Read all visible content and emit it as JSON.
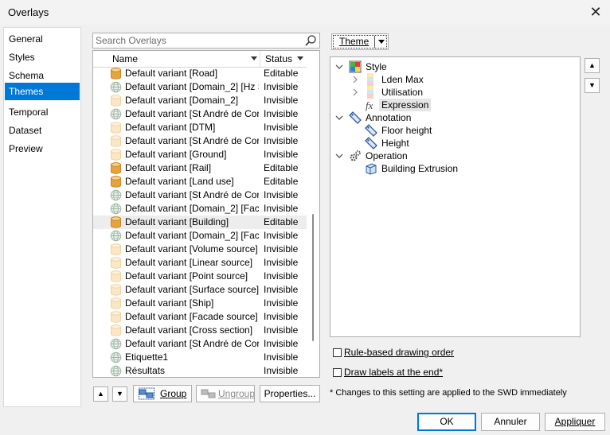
{
  "window": {
    "title": "Overlays"
  },
  "nav": {
    "items": [
      {
        "label": "General"
      },
      {
        "label": "Styles"
      },
      {
        "label": "Schema"
      },
      {
        "label": "Themes"
      },
      {
        "label": "Temporal"
      },
      {
        "label": "Dataset"
      },
      {
        "label": "Preview"
      }
    ],
    "selected": "Themes"
  },
  "search": {
    "placeholder": "Search Overlays",
    "value": ""
  },
  "list": {
    "headers": {
      "name": "Name",
      "status": "Status"
    },
    "rows": [
      {
        "name": "Default variant [Road]",
        "status": "Editable",
        "icon": "database-icon"
      },
      {
        "name": "Default variant [Domain_2] [Hz Si...",
        "status": "Invisible",
        "icon": "globe-icon"
      },
      {
        "name": "Default variant [Domain_2]",
        "status": "Invisible",
        "icon": "database-faded-icon"
      },
      {
        "name": "Default variant [St André de Corc...",
        "status": "Invisible",
        "icon": "globe-icon"
      },
      {
        "name": "Default variant [DTM]",
        "status": "Invisible",
        "icon": "database-faded-icon"
      },
      {
        "name": "Default variant [St André de Corcy]",
        "status": "Invisible",
        "icon": "database-faded-icon"
      },
      {
        "name": "Default variant [Ground]",
        "status": "Invisible",
        "icon": "database-faded-icon"
      },
      {
        "name": "Default variant [Rail]",
        "status": "Editable",
        "icon": "database-icon"
      },
      {
        "name": "Default variant [Land use]",
        "status": "Editable",
        "icon": "database-icon"
      },
      {
        "name": "Default variant [St André de Corc...",
        "status": "Invisible",
        "icon": "globe-icon"
      },
      {
        "name": "Default variant [Domain_2] [Faca...",
        "status": "Invisible",
        "icon": "globe-icon"
      },
      {
        "name": "Default variant [Building]",
        "status": "Editable",
        "icon": "database-icon",
        "selected": true
      },
      {
        "name": "Default variant [Domain_2] [Faca...",
        "status": "Invisible",
        "icon": "globe-icon"
      },
      {
        "name": "Default variant [Volume source]",
        "status": "Invisible",
        "icon": "database-faded-icon"
      },
      {
        "name": "Default variant [Linear source]",
        "status": "Invisible",
        "icon": "database-faded-icon"
      },
      {
        "name": "Default variant [Point source]",
        "status": "Invisible",
        "icon": "database-faded-icon"
      },
      {
        "name": "Default variant [Surface source]",
        "status": "Invisible",
        "icon": "database-faded-icon"
      },
      {
        "name": "Default variant [Ship]",
        "status": "Invisible",
        "icon": "database-faded-icon"
      },
      {
        "name": "Default variant [Facade source]",
        "status": "Invisible",
        "icon": "database-faded-icon"
      },
      {
        "name": "Default variant [Cross section]",
        "status": "Invisible",
        "icon": "database-faded-icon"
      },
      {
        "name": "Default variant [St André de Corc...",
        "status": "Invisible",
        "icon": "globe-icon"
      },
      {
        "name": "Etiquette1",
        "status": "Invisible",
        "icon": "globe-icon"
      },
      {
        "name": "Résultats",
        "status": "Invisible",
        "icon": "globe-icon"
      }
    ]
  },
  "list_buttons": {
    "up": "▲",
    "down": "▼",
    "group": "Group",
    "ungroup": "Ungroup",
    "properties": "Properties..."
  },
  "theme": {
    "button_label": "Theme",
    "tree": [
      {
        "label": "Style",
        "level": 0,
        "icon": "style-palette-icon",
        "expander": "down"
      },
      {
        "label": "Lden Max",
        "level": 1,
        "icon": "color-ramp-icon",
        "expander": "right"
      },
      {
        "label": "Utilisation",
        "level": 1,
        "icon": "color-ramp-icon",
        "expander": "right"
      },
      {
        "label": "Expression",
        "level": 1,
        "icon": "fx-icon",
        "expander": "",
        "selected": true
      },
      {
        "label": "Annotation",
        "level": 0,
        "icon": "tag-icon",
        "expander": "down"
      },
      {
        "label": "Floor height",
        "level": 1,
        "icon": "tag-icon",
        "expander": ""
      },
      {
        "label": "Height",
        "level": 1,
        "icon": "tag-icon",
        "expander": ""
      },
      {
        "label": "Operation",
        "level": 0,
        "icon": "gears-icon",
        "expander": "down"
      },
      {
        "label": "Building Extrusion",
        "level": 1,
        "icon": "building-icon",
        "expander": ""
      }
    ],
    "move_up": "▲",
    "move_down": "▼"
  },
  "options": {
    "rule_based": {
      "label": "Rule-based drawing order",
      "checked": false
    },
    "draw_labels": {
      "label": "Draw labels at the end*",
      "checked": false
    },
    "note": "* Changes to this setting are applied to the SWD immediately"
  },
  "footer": {
    "ok": "OK",
    "cancel": "Annuler",
    "apply": "Appliquer"
  },
  "colors": {
    "accent": "#0078d7",
    "db_gold": "#e6a33e",
    "tag_blue": "#2c5aa0"
  }
}
